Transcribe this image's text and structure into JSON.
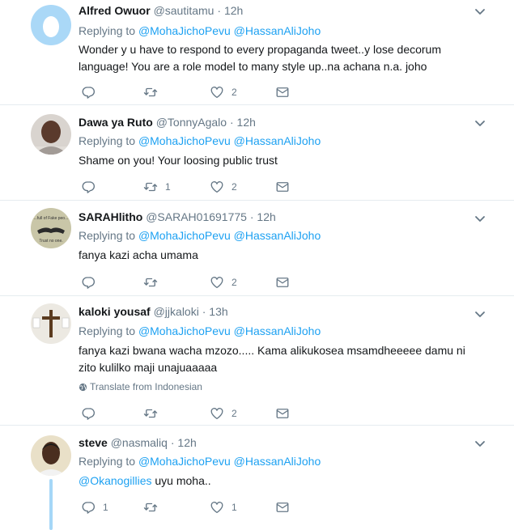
{
  "tweets": [
    {
      "name": "Alfred Owuor",
      "handle": "@sautitamu",
      "time": "12h",
      "replying_prefix": "Replying to",
      "reply_to_1": "@MohaJichoPevu",
      "reply_to_2": "@HassanAliJoho",
      "text": "Wonder y u have to respond to every propaganda tweet..y lose decorum language! You are a role model to many style up..na achana n.a. joho",
      "replies": "",
      "retweets": "",
      "likes": "2"
    },
    {
      "name": "Dawa ya Ruto",
      "handle": "@TonnyAgalo",
      "time": "12h",
      "replying_prefix": "Replying to",
      "reply_to_1": "@MohaJichoPevu",
      "reply_to_2": "@HassanAliJoho",
      "text": "Shame on you! Your loosing public trust",
      "replies": "",
      "retweets": "1",
      "likes": "2"
    },
    {
      "name": "SARAHlitho",
      "handle": "@SARAH01691775",
      "time": "12h",
      "replying_prefix": "Replying to",
      "reply_to_1": "@MohaJichoPevu",
      "reply_to_2": "@HassanAliJoho",
      "text": "fanya kazi acha umama",
      "avatar_text_1": "...full of Fake peo...",
      "avatar_text_2": "Trust no one.",
      "replies": "",
      "retweets": "",
      "likes": "2"
    },
    {
      "name": "kaloki yousaf",
      "handle": "@jjkaloki",
      "time": "13h",
      "replying_prefix": "Replying to",
      "reply_to_1": "@MohaJichoPevu",
      "reply_to_2": "@HassanAliJoho",
      "text": "fanya kazi bwana wacha mzozo..... Kama alikukosea msamdheeeee damu ni zito kulilko maji unajuaaaaa",
      "translate": "Translate from Indonesian",
      "replies": "",
      "retweets": "",
      "likes": "2"
    },
    {
      "name": "steve",
      "handle": "@nasmaliq",
      "time": "12h",
      "replying_prefix": "Replying to",
      "reply_to_1": "@MohaJichoPevu",
      "reply_to_2": "@HassanAliJoho",
      "mention": "@Okanogillies",
      "text": " uyu moha..",
      "replies": "1",
      "retweets": "",
      "likes": "1"
    }
  ],
  "separator_dot": "·",
  "colors": {
    "accent": "#1da1f2",
    "secondary_text": "#657786",
    "divider": "#e6ecf0",
    "thread_line": "#a5d7f7"
  },
  "icons": [
    "chevron-down-icon",
    "reply-icon",
    "retweet-icon",
    "heart-icon",
    "envelope-icon",
    "globe-icon"
  ]
}
